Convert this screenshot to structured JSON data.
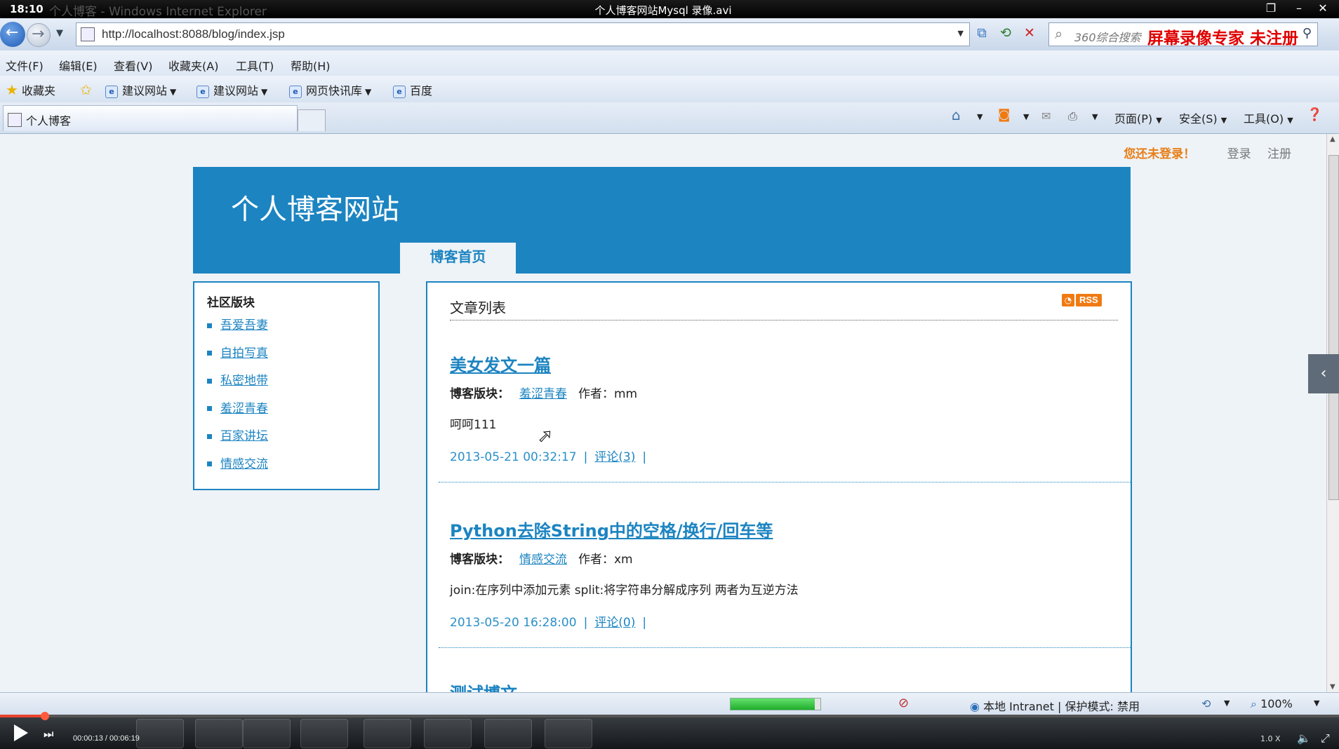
{
  "titlebar": {
    "time": "18:10",
    "ghost_title": "个人博客 - Windows Internet Explorer",
    "video_title": "个人博客网站Mysql 录像.avi"
  },
  "address": {
    "url": "http://localhost:8088/blog/index.jsp",
    "search_placeholder": "360综合搜索",
    "recorder_watermark": "屏幕录像专家 未注册"
  },
  "menu": [
    "文件(F)",
    "编辑(E)",
    "查看(V)",
    "收藏夹(A)",
    "工具(T)",
    "帮助(H)"
  ],
  "favorites": {
    "label": "收藏夹",
    "items": [
      "建议网站",
      "建议网站",
      "网页快讯库",
      "百度"
    ]
  },
  "tab": {
    "title": "个人博客"
  },
  "commandbar": {
    "page": "页面(P)",
    "safety": "安全(S)",
    "tools": "工具(O)"
  },
  "page": {
    "not_logged_in": "您还未登录！",
    "login": "登录",
    "register": "注册",
    "site_title": "个人博客网站",
    "nav_tab": "博客首页",
    "sidebar": {
      "heading": "社区版块",
      "items": [
        "吾爱吾妻",
        "自拍写真",
        "私密地带",
        "羞涩青春",
        "百家讲坛",
        "情感交流"
      ]
    },
    "main": {
      "heading": "文章列表",
      "rss": "RSS",
      "articles": [
        {
          "title": "美女发文一篇",
          "board_label": "博客版块：",
          "board": "羞涩青春",
          "author_label": "作者：",
          "author": "mm",
          "summary": "呵呵111",
          "date": "2013-05-21 00:32:17",
          "comments": "评论(3)"
        },
        {
          "title": "Python去除String中的空格/换行/回车等",
          "board_label": "博客版块：",
          "board": "情感交流",
          "author_label": "作者：",
          "author": "xm",
          "summary": "join:在序列中添加元素  split:将字符串分解成序列  两者为互逆方法",
          "date": "2013-05-20 16:28:00",
          "comments": "评论(0)"
        },
        {
          "title": "测试博文"
        }
      ]
    }
  },
  "statusbar": {
    "zone": "本地 Intranet | 保护模式: 禁用",
    "zoom": "100%"
  },
  "player": {
    "timecode": "00:00:13 / 00:06:19",
    "speed": "1.0 X",
    "playback_progress": 0.034
  },
  "colors": {
    "brand_blue": "#1c84c1",
    "warning_orange": "#e87d16",
    "rss_orange": "#f07a12",
    "watermark_red": "#e00000"
  }
}
